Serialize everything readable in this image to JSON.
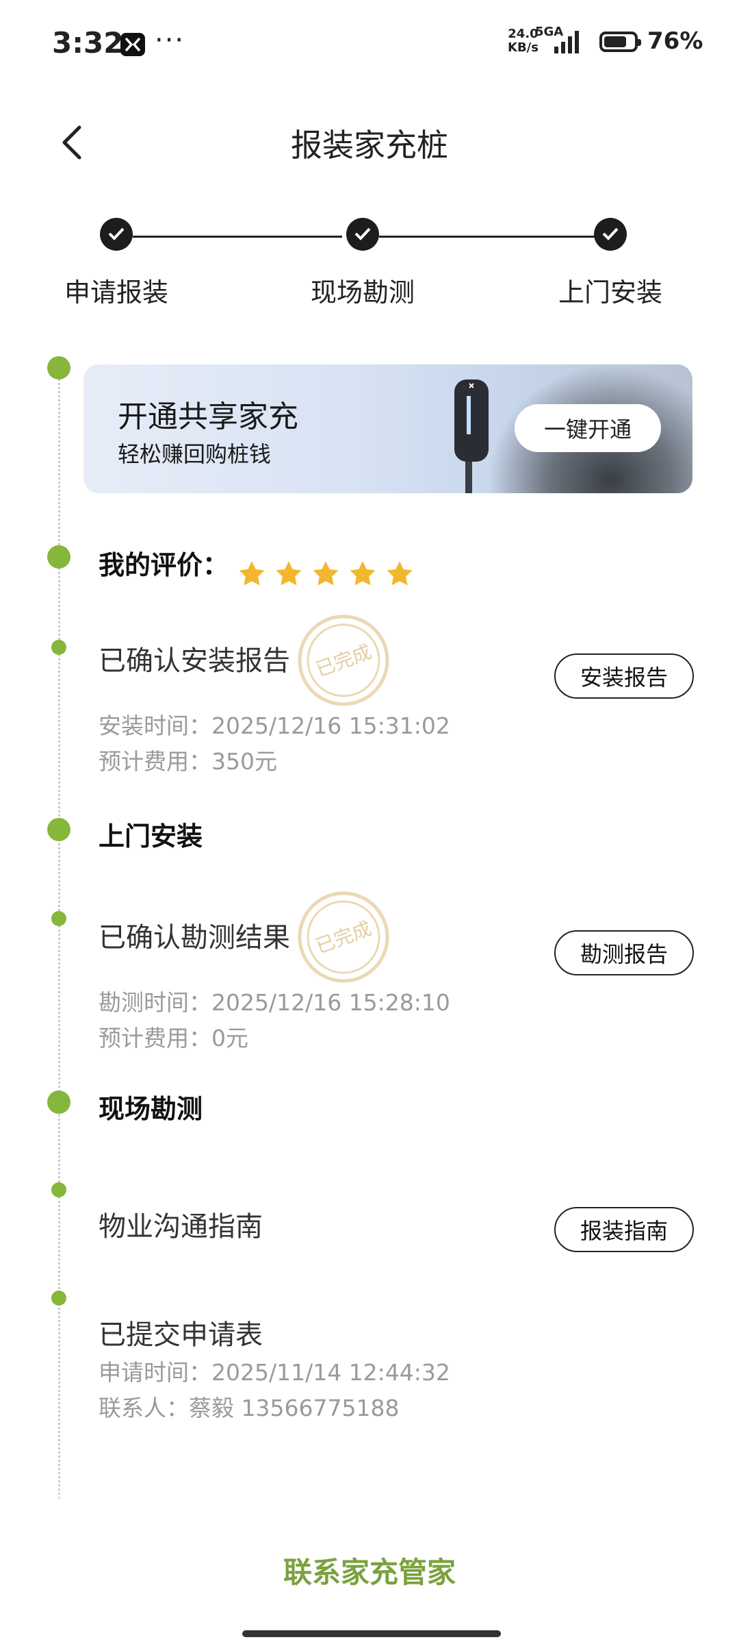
{
  "status_bar": {
    "time": "3:32",
    "overflow": "···",
    "net_speed_value": "24.0",
    "net_speed_unit": "KB/s",
    "network_type": "5GA",
    "battery_percent_text": "76%",
    "battery_level": 0.76
  },
  "header": {
    "title": "报装家充桩"
  },
  "stepper": {
    "steps": [
      "申请报装",
      "现场勘测",
      "上门安装"
    ]
  },
  "banner": {
    "title": "开通共享家充",
    "subtitle": "轻松赚回购桩钱",
    "button": "一键开通"
  },
  "rating": {
    "label": "我的评价：",
    "stars": 5
  },
  "timeline": {
    "install_report": {
      "title": "已确认安装报告",
      "stamp": "已完成",
      "time_label": "安装时间：",
      "time_value": "2025/12/16 15:31:02",
      "fee_label": "预计费用：",
      "fee_value": "350元",
      "button": "安装报告"
    },
    "install_section": "上门安装",
    "survey_result": {
      "title": "已确认勘测结果",
      "stamp": "已完成",
      "time_label": "勘测时间：",
      "time_value": "2025/12/16 15:28:10",
      "fee_label": "预计费用：",
      "fee_value": "0元",
      "button": "勘测报告"
    },
    "survey_section": "现场勘测",
    "guide": {
      "title": "物业沟通指南",
      "button": "报装指南"
    },
    "application": {
      "title": "已提交申请表",
      "time_label": "申请时间：",
      "time_value": "2025/11/14 12:44:32",
      "contact_label": "联系人：",
      "contact_value": "蔡毅 13566775188"
    }
  },
  "footer": {
    "contact_button": "联系家充管家"
  },
  "colors": {
    "accent_green": "#86b63c",
    "footer_green": "#7aa23e",
    "star": "#f2b72e"
  }
}
